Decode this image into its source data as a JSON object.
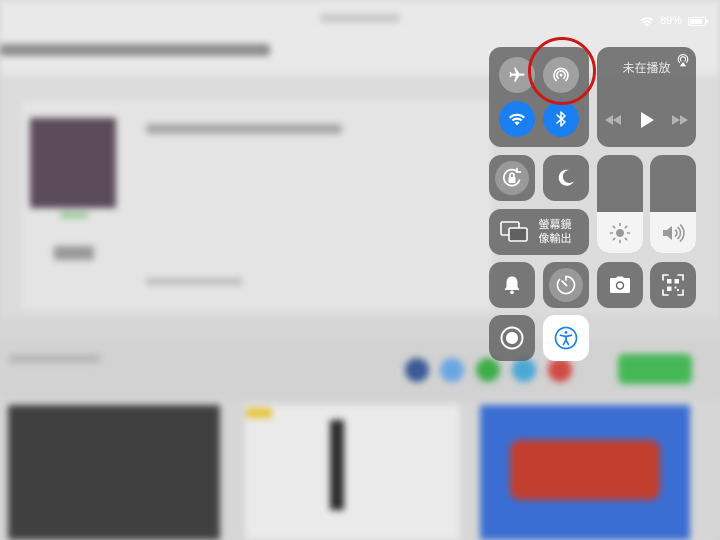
{
  "status_bar": {
    "battery_text": "89%",
    "battery_level": 0.89
  },
  "control_center": {
    "connectivity": {
      "airplane_icon": "airplane-icon",
      "airdrop_icon": "airdrop-icon",
      "wifi_icon": "wifi-icon",
      "bluetooth_icon": "bluetooth-icon"
    },
    "now_playing": {
      "title": "未在播放",
      "airplay_icon": "airplay-audio-icon"
    },
    "screen_mirroring": {
      "line1": "螢幕鏡",
      "line2": "像輸出"
    },
    "brightness_level": 0.42,
    "volume_level": 0.42,
    "colors": {
      "accent_blue": "#1a80f2",
      "highlight_red": "#cc1717"
    }
  }
}
